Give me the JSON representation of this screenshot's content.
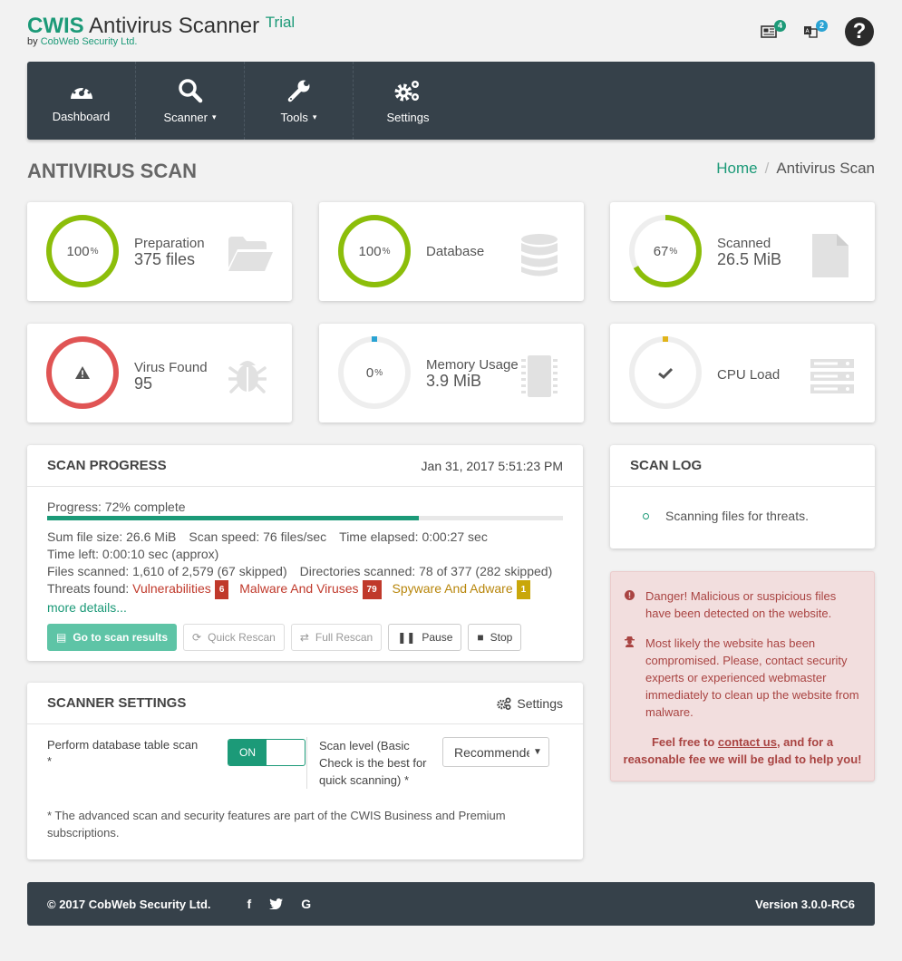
{
  "brand": {
    "name": "CWIS",
    "product": "Antivirus Scanner",
    "edition": "Trial",
    "byline_prefix": "by",
    "company": "CobWeb Security Ltd."
  },
  "top_icons": {
    "news_badge": "4",
    "lang_badge": "2",
    "help_icon": "?"
  },
  "nav": [
    {
      "label": "Dashboard",
      "icon": "dashboard-gauge-icon",
      "caret": ""
    },
    {
      "label": "Scanner",
      "icon": "search-icon",
      "caret": "▾"
    },
    {
      "label": "Tools",
      "icon": "wrench-icon",
      "caret": "▾"
    },
    {
      "label": "Settings",
      "icon": "gears-icon",
      "caret": ""
    }
  ],
  "page": {
    "title": "ANTIVIRUS SCAN",
    "breadcrumb_home": "Home",
    "breadcrumb_sep": "/",
    "breadcrumb_current": "Antivirus Scan"
  },
  "stats": {
    "preparation": {
      "percent": "100",
      "percent_sign": "%",
      "label": "Preparation",
      "value": "375 files",
      "progress": 1.0
    },
    "database": {
      "percent": "100",
      "percent_sign": "%",
      "label": "Database",
      "progress": 1.0
    },
    "scanned": {
      "percent": "67",
      "percent_sign": "%",
      "label": "Scanned",
      "value": "26.5 MiB",
      "progress": 0.67
    },
    "virus": {
      "label": "Virus Found",
      "value": "95"
    },
    "memory": {
      "percent": "0",
      "percent_sign": "%",
      "label": "Memory Usage",
      "value": "3.9 MiB",
      "progress": 0.0
    },
    "cpu": {
      "label": "CPU Load",
      "progress": 0.0
    }
  },
  "scan_progress": {
    "title": "SCAN PROGRESS",
    "timestamp": "Jan 31, 2017 5:51:23 PM",
    "progress_text": "Progress: 72% complete",
    "progress": 0.72,
    "sum_size": "Sum file size: 26.6 MiB",
    "speed": "Scan speed: 76 files/sec",
    "elapsed": "Time elapsed: 0:00:27 sec",
    "time_left": "Time left: 0:00:10 sec (approx)",
    "files_scanned": "Files scanned: 1,610 of 2,579 (67 skipped)",
    "dirs_scanned": "Directories scanned: 78 of 377 (282 skipped)",
    "threats_label": "Threats found:",
    "threats": [
      {
        "label": "Vulnerabilities",
        "count": "6"
      },
      {
        "label": "Malware And Viruses",
        "count": "79"
      },
      {
        "label": "Spyware And Adware",
        "count": "1"
      }
    ],
    "more": "more details...",
    "buttons": {
      "results": "Go to scan results",
      "quick": "Quick Rescan",
      "full": "Full Rescan",
      "pause": "Pause",
      "stop": "Stop"
    }
  },
  "scanner_settings": {
    "title": "SCANNER SETTINGS",
    "settings_link": "Settings",
    "db_scan_label": "Perform database table scan",
    "asterisk": "*",
    "toggle_on": "ON",
    "scan_level_label": "Scan level (Basic Check is the best for quick scanning)",
    "scan_level_value": "Recommended",
    "footnote": "* The advanced scan and security features are part of the CWIS Business and Premium subscriptions."
  },
  "scan_log": {
    "title": "SCAN LOG",
    "entries": [
      "Scanning files for threats."
    ]
  },
  "danger": {
    "line1": "Danger! Malicious or suspicious files have been detected on the website.",
    "line2": "Most likely the website has been compromised. Please, contact security experts or experienced webmaster immediately to clean up the website from malware.",
    "foot_pre": "Feel free to",
    "foot_link": "contact us",
    "foot_post": ", and for a reasonable fee we will be glad to help you!"
  },
  "footer": {
    "copyright": "© 2017 CobWeb Security Ltd.",
    "social": [
      "f",
      "t",
      "G"
    ],
    "version": "Version 3.0.0-RC6"
  },
  "colors": {
    "green": "#8cbe0a",
    "teal": "#1c9a78",
    "red": "#e05454",
    "navy": "#36414a",
    "memory_dot": "#2aa3d3",
    "cpu_dot": "#e1b41a"
  }
}
